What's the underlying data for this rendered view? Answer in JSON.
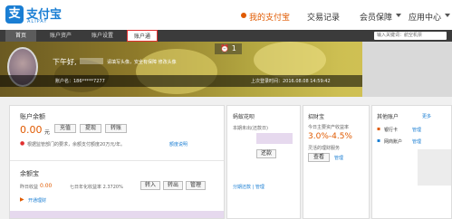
{
  "logo": {
    "mark": "支",
    "text": "支付宝",
    "sub": "ALIPAY"
  },
  "main_nav": [
    "我的支付宝",
    "交易记录",
    "会员保障",
    "应用中心"
  ],
  "sub_nav": [
    "首页",
    "账户资产",
    "账户设置",
    "账户通"
  ],
  "search": {
    "placeholder": "输入关键词：航空机票"
  },
  "banner": {
    "alarm_count": "1",
    "greeting": "下午好,",
    "tip": "请填写头像，安全有保障 修改头像",
    "account": "账户名：186*****7277",
    "last_login": "上次登录时间：2016.08.08 14:59:42"
  },
  "balance": {
    "title": "账户余额",
    "amount": "0.00",
    "unit": "元",
    "btn_recharge": "充值",
    "btn_withdraw": "提现",
    "btn_transfer": "转账",
    "notice": "根据监管部门的要求，余额支付额度20万元/年。",
    "notice_link": "额度说明"
  },
  "huabei": {
    "title": "蚂蚁花呗",
    "line1": "本期未出(还款日)",
    "btn": "还款",
    "links": "分期还款 | 管理"
  },
  "zhaocai": {
    "title": "招财宝",
    "line1": "今日主要资产收益率",
    "rate": "3.0%-4.5%",
    "line3": "灵活的理财服务",
    "btn": "查看",
    "link": "管理"
  },
  "others": {
    "title": "其他账户",
    "link": "更多",
    "item1": "银行卡",
    "item1_link": "管理",
    "item2": "网商账户",
    "item2_link": "管理"
  },
  "yuebao": {
    "title": "余额宝",
    "yesterday_label": "昨日收益",
    "yesterday_value": "0.00",
    "rate": "七日年化收益率 2.3720%",
    "btn_in": "转入",
    "btn_out": "转出",
    "btn_manage": "管理",
    "link": "开通理财"
  }
}
